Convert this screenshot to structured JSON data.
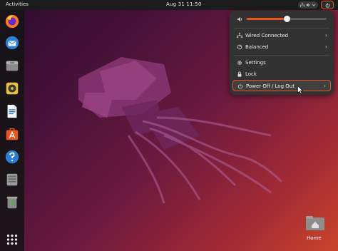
{
  "topbar": {
    "activities_label": "Activities",
    "clock": "Aug 31  11:50",
    "tray_icons": [
      "network-icon",
      "volume-icon",
      "chevron-down-icon"
    ],
    "power_icon": "power-icon"
  },
  "dock": {
    "items": [
      {
        "name": "firefox",
        "icon": "firefox-icon"
      },
      {
        "name": "thunderbird",
        "icon": "thunderbird-icon"
      },
      {
        "name": "files",
        "icon": "files-icon"
      },
      {
        "name": "rhythmbox",
        "icon": "rhythmbox-icon"
      },
      {
        "name": "libreoffice-writer",
        "icon": "writer-icon"
      },
      {
        "name": "ubuntu-software",
        "icon": "software-icon"
      },
      {
        "name": "help",
        "icon": "help-icon"
      },
      {
        "name": "disk",
        "icon": "disk-icon"
      },
      {
        "name": "trash",
        "icon": "trash-icon"
      },
      {
        "name": "show-applications",
        "icon": "apps-grid-icon"
      }
    ]
  },
  "desktop": {
    "home_label": "Home"
  },
  "quick_settings": {
    "volume_level": 0.5,
    "wired_label": "Wired Connected",
    "power_mode_label": "Balanced",
    "settings_label": "Settings",
    "lock_label": "Lock",
    "poweroff_label": "Power Off / Log Out",
    "accent_color": "#e95420"
  }
}
